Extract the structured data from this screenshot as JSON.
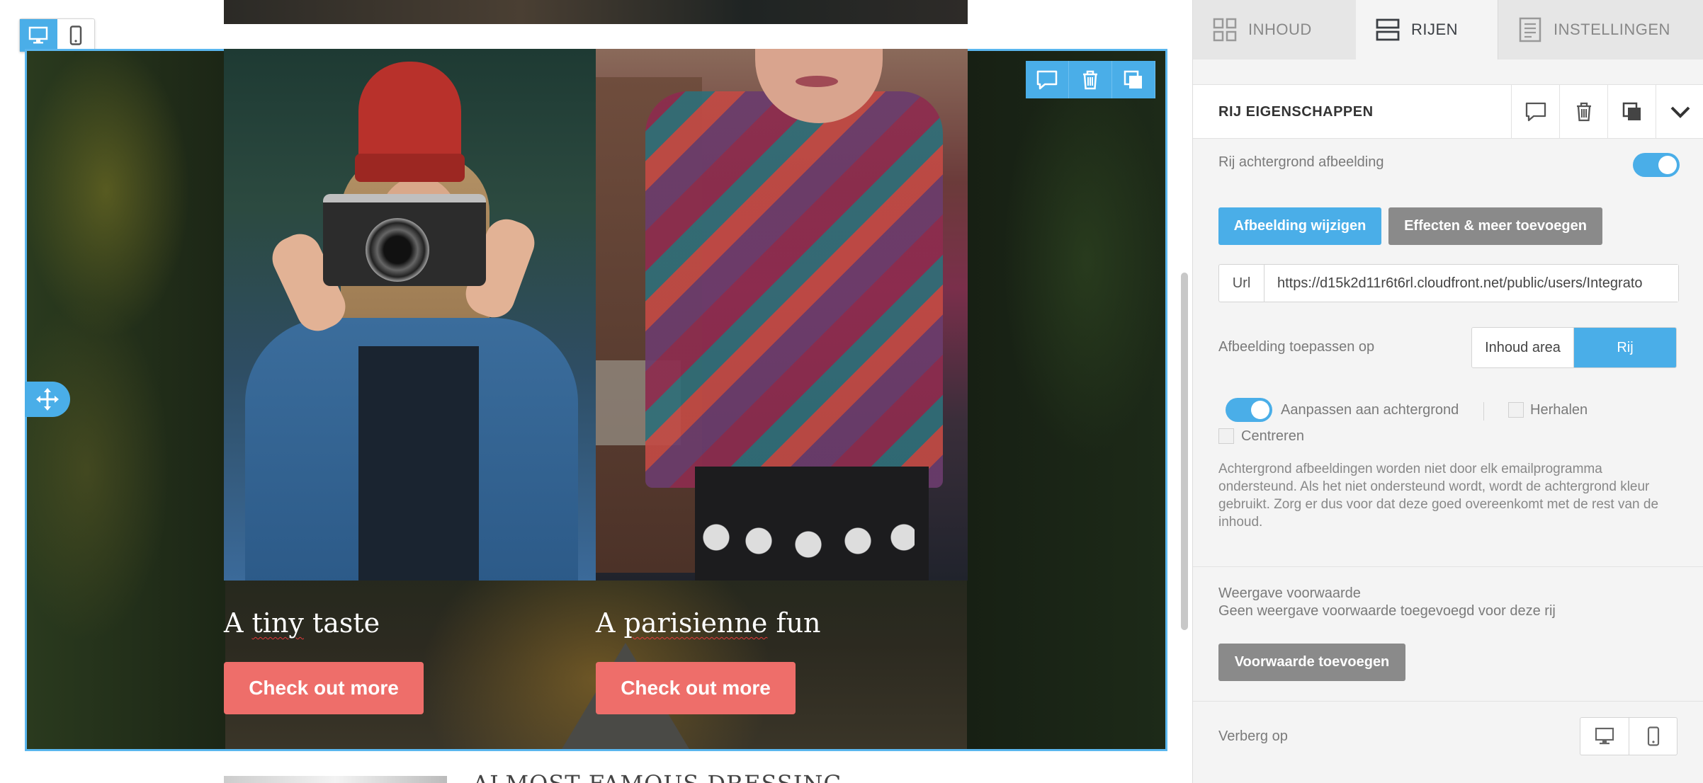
{
  "colors": {
    "accent": "#4aaee8",
    "cta": "#ee6e6a",
    "grey_button": "#8a8a8a"
  },
  "device_toggle": {
    "desktop_icon": "desktop-icon",
    "mobile_icon": "mobile-icon",
    "active": "desktop"
  },
  "canvas": {
    "row_tools": [
      "comment-icon",
      "trash-icon",
      "duplicate-icon"
    ],
    "move_icon": "move-arrows-icon",
    "columns": [
      {
        "caption_pre": "A ",
        "caption_wavy": "tiny",
        "caption_post": " taste",
        "button": "Check out more"
      },
      {
        "caption_pre": "A ",
        "caption_wavy": "parisienne",
        "caption_post": " fun",
        "button": "Check out more"
      }
    ],
    "next_row_text": "ALMOST FAMOUS DRESSING"
  },
  "tabs": [
    {
      "label": "INHOUD",
      "icon": "grid-icon"
    },
    {
      "label": "RIJEN",
      "icon": "rows-icon",
      "active": true
    },
    {
      "label": "INSTELLINGEN",
      "icon": "settings-doc-icon"
    }
  ],
  "properties": {
    "title": "RIJ EIGENSCHAPPEN",
    "bg_image_label": "Rij achtergrond afbeelding",
    "bg_image_enabled": true,
    "change_image_button": "Afbeelding wijzigen",
    "effects_button": "Effecten & meer toevoegen",
    "url_label": "Url",
    "url_value": "https://d15k2d11r6t6rl.cloudfront.net/public/users/Integrato",
    "apply_label": "Afbeelding toepassen op",
    "apply_options": [
      "Inhoud area",
      "Rij"
    ],
    "apply_selected": "Rij",
    "fit_label": "Aanpassen aan achtergrond",
    "fit_enabled": true,
    "repeat_label": "Herhalen",
    "center_label": "Centreren",
    "note": "Achtergrond afbeeldingen worden niet door elk emailprogramma ondersteund. Als het niet ondersteund wordt, wordt de achtergrond kleur gebruikt. Zorg er dus voor dat deze goed overeenkomt met de rest van de inhoud.",
    "condition_title": "Weergave voorwaarde",
    "condition_desc": "Geen weergave voorwaarde toegevoegd voor deze rij",
    "condition_button": "Voorwaarde toevoegen",
    "hide_label": "Verberg op"
  }
}
